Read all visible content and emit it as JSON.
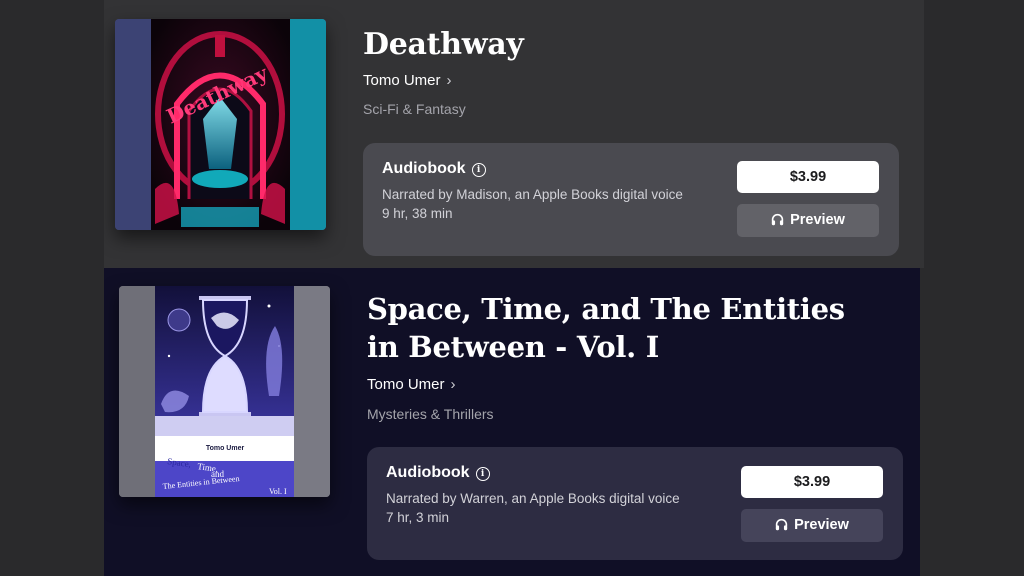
{
  "books": [
    {
      "title": "Deathway",
      "author": "Tomo Umer",
      "author_chevron": "›",
      "genre": "Sci-Fi & Fantasy",
      "format": "Audiobook",
      "info_icon": "i",
      "narration": "Narrated by Madison, an Apple Books digital voice",
      "duration": "9 hr, 38 min",
      "price": "$3.99",
      "preview_label": "Preview",
      "cover_colors": {
        "accent": "#e4124c",
        "glow": "#13c6d6"
      }
    },
    {
      "title": "Space, Time, and The Entities in Between - Vol. I",
      "author": "Tomo Umer",
      "author_chevron": "›",
      "genre": "Mysteries & Thrillers",
      "format": "Audiobook",
      "info_icon": "i",
      "narration": "Narrated by Warren, an Apple Books digital voice",
      "duration": "7 hr, 3 min",
      "price": "$3.99",
      "preview_label": "Preview",
      "cover_author": "Tomo Umer",
      "cover_title_lines": [
        "Space,",
        "Time,",
        "and",
        "The Entities in Between",
        "Vol. I"
      ],
      "cover_colors": {
        "accent": "#5a4fd2",
        "sky": "#1e1a55"
      }
    }
  ]
}
